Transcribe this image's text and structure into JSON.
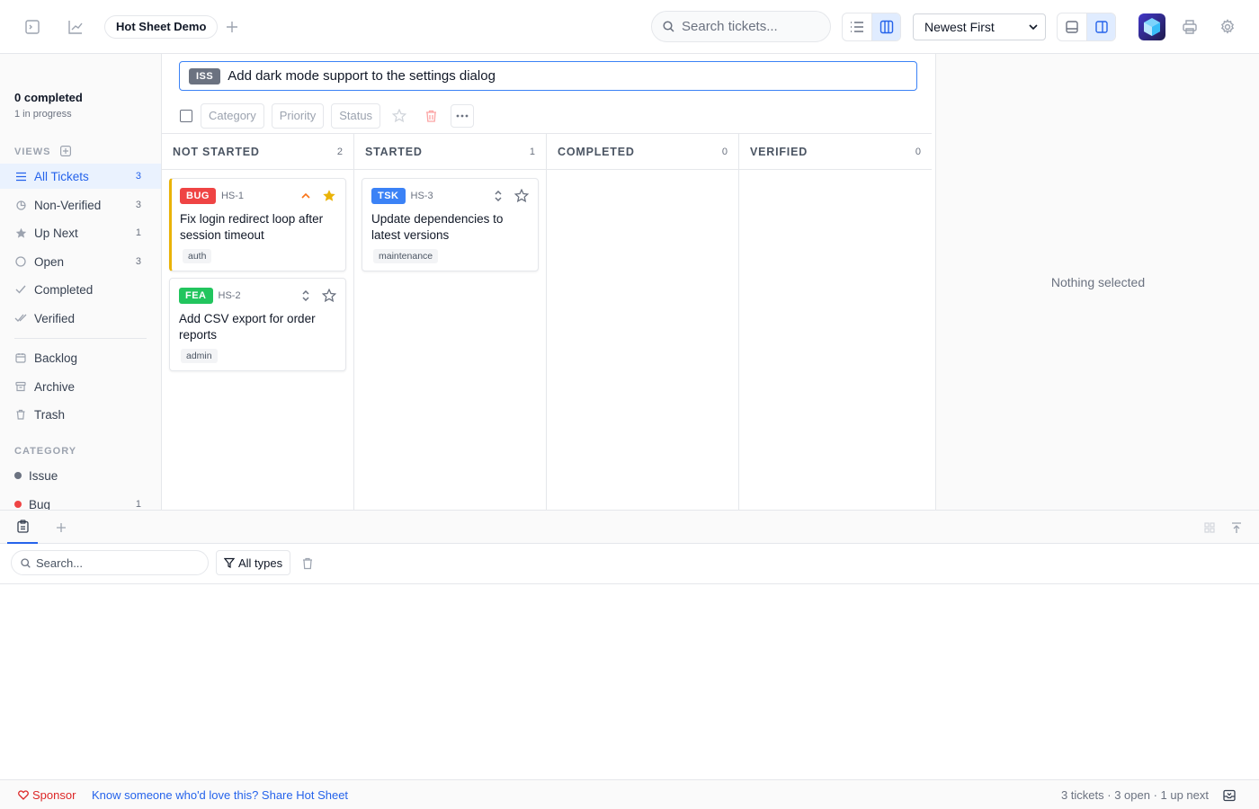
{
  "header": {
    "project_tab": "Hot Sheet Demo",
    "search_placeholder": "Search tickets...",
    "sort_selected": "Newest First",
    "icons": [
      "terminal-icon",
      "chart-icon",
      "plus-icon",
      "search-icon",
      "list-view-icon",
      "board-view-icon",
      "bottom-panel-icon",
      "side-panel-icon",
      "app-logo",
      "print-icon",
      "gear-icon"
    ]
  },
  "sidebar": {
    "summary_completed": "0 completed",
    "summary_in_progress": "1 in progress",
    "views_heading": "VIEWS",
    "views": [
      {
        "label": "All Tickets",
        "count": "3",
        "icon": "list-icon",
        "active": true
      },
      {
        "label": "Non-Verified",
        "count": "3",
        "icon": "half-circle-icon"
      },
      {
        "label": "Up Next",
        "count": "1",
        "icon": "star-icon"
      },
      {
        "label": "Open",
        "count": "3",
        "icon": "circle-icon"
      },
      {
        "label": "Completed",
        "count": "",
        "icon": "check-icon"
      },
      {
        "label": "Verified",
        "count": "",
        "icon": "double-check-icon"
      }
    ],
    "extra": [
      {
        "label": "Backlog",
        "icon": "calendar-icon"
      },
      {
        "label": "Archive",
        "icon": "archive-icon"
      },
      {
        "label": "Trash",
        "icon": "trash-icon"
      }
    ],
    "category_heading": "CATEGORY",
    "categories": [
      {
        "label": "Issue",
        "count": "",
        "color": "#6b7280"
      },
      {
        "label": "Bug",
        "count": "1",
        "color": "#ef4444"
      }
    ]
  },
  "new_ticket": {
    "category": "ISS",
    "value": "Add dark mode support to the settings dialog"
  },
  "toolbar": {
    "category_label": "Category",
    "priority_label": "Priority",
    "status_label": "Status"
  },
  "board": {
    "columns": [
      {
        "title": "NOT STARTED",
        "count": "2"
      },
      {
        "title": "STARTED",
        "count": "1"
      },
      {
        "title": "COMPLETED",
        "count": "0"
      },
      {
        "title": "VERIFIED",
        "count": "0"
      }
    ],
    "cards": [
      {
        "category": "BUG",
        "category_color": "#ef4444",
        "id": "HS-1",
        "title": "Fix login redirect loop after session timeout",
        "tag": "auth",
        "priority": "high",
        "up_next": true
      },
      {
        "category": "FEA",
        "category_color": "#22c55e",
        "id": "HS-2",
        "title": "Add CSV export for order reports",
        "tag": "admin",
        "priority": "normal",
        "up_next": false
      },
      {
        "category": "TSK",
        "category_color": "#3b82f6",
        "id": "HS-3",
        "title": "Update dependencies to latest versions",
        "tag": "maintenance",
        "priority": "normal",
        "up_next": false
      }
    ]
  },
  "detail": {
    "empty_text": "Nothing selected"
  },
  "bottom_panel": {
    "search_placeholder": "Search...",
    "types_label": "All types"
  },
  "footer": {
    "sponsor_label": "Sponsor",
    "share_text": "Know someone who'd love this? Share Hot Sheet",
    "stats": "3 tickets · 3 open · 1 up next"
  },
  "colors": {
    "accent": "#2563eb",
    "up_next": "#eab308",
    "danger": "#ef4444"
  }
}
